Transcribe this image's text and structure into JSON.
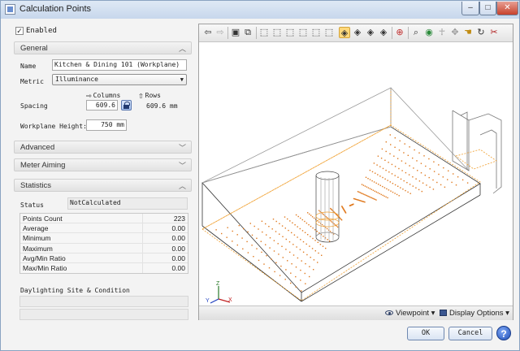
{
  "window": {
    "title": "Calculation Points"
  },
  "enabled": {
    "label": "Enabled",
    "checked": true
  },
  "sections": {
    "general": "General",
    "advanced": "Advanced",
    "meter_aiming": "Meter Aiming",
    "statistics": "Statistics"
  },
  "general": {
    "name_label": "Name",
    "name_value": "Kitchen & Dining 101 (Workplane)",
    "metric_label": "Metric",
    "metric_value": "Illuminance",
    "columns_label": "Columns",
    "rows_label": "Rows",
    "spacing_label": "Spacing",
    "spacing_columns": "609.6",
    "spacing_rows": "609.6 mm",
    "workplane_label": "Workplane Height:",
    "workplane_value": "750 mm"
  },
  "statistics": {
    "status_label": "Status",
    "status_value": "NotCalculated",
    "rows": [
      {
        "label": "Points Count",
        "value": "223"
      },
      {
        "label": "Average",
        "value": "0.00"
      },
      {
        "label": "Minimum",
        "value": "0.00"
      },
      {
        "label": "Maximum",
        "value": "0.00"
      },
      {
        "label": "Avg/Min Ratio",
        "value": "0.00"
      },
      {
        "label": "Max/Min Ratio",
        "value": "0.00"
      }
    ]
  },
  "daylighting": {
    "label": "Daylighting Site & Condition"
  },
  "viewport": {
    "viewpoint_label": "Viewpoint",
    "display_options_label": "Display Options",
    "axis_x": "X",
    "axis_y": "Y",
    "axis_z": "Z"
  },
  "buttons": {
    "ok": "OK",
    "cancel": "Cancel"
  },
  "colors": {
    "accent_orange": "#f0a030",
    "selection_yellow": "#ffd87a"
  }
}
